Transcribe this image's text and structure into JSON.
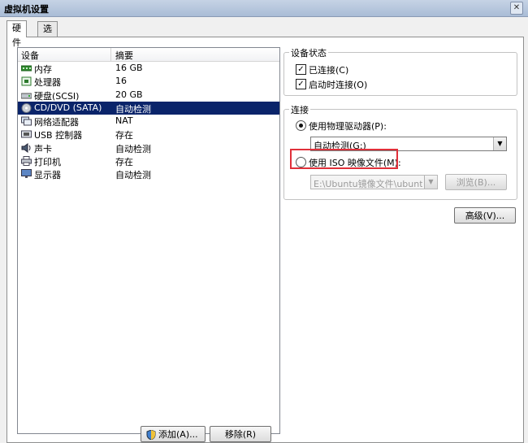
{
  "window": {
    "title": "虚拟机设置",
    "close": "✕"
  },
  "tabs": [
    {
      "label": "硬件"
    },
    {
      "label": "选项"
    }
  ],
  "device_list": {
    "headers": {
      "device": "设备",
      "summary": "摘要"
    },
    "rows": [
      {
        "name": "内存",
        "summary": "16 GB",
        "icon": "memory-icon"
      },
      {
        "name": "处理器",
        "summary": "16",
        "icon": "processor-icon"
      },
      {
        "name": "硬盘(SCSI)",
        "summary": "20 GB",
        "icon": "hard-disk-icon"
      },
      {
        "name": "CD/DVD (SATA)",
        "summary": "自动检测",
        "icon": "cd-dvd-icon"
      },
      {
        "name": "网络适配器",
        "summary": "NAT",
        "icon": "network-adapter-icon"
      },
      {
        "name": "USB 控制器",
        "summary": "存在",
        "icon": "usb-icon"
      },
      {
        "name": "声卡",
        "summary": "自动检测",
        "icon": "speaker-icon"
      },
      {
        "name": "打印机",
        "summary": "存在",
        "icon": "printer-icon"
      },
      {
        "name": "显示器",
        "summary": "自动检测",
        "icon": "monitor-icon"
      }
    ],
    "add_button": "添加(A)...",
    "remove_button": "移除(R)"
  },
  "device_status": {
    "legend": "设备状态",
    "connected": {
      "label": "已连接(C)",
      "checked": "✓"
    },
    "connect_at_power_on": {
      "label": "启动时连接(O)",
      "checked": "✓"
    }
  },
  "connection": {
    "legend": "连接",
    "physical_drive": {
      "label": "使用物理驱动器(P):",
      "value": "自动检测(G:)"
    },
    "iso_image": {
      "label": "使用 ISO 映像文件(M):",
      "path": "E:\\Ubuntu镜像文件\\ubuntu-",
      "browse": "浏览(B)..."
    }
  },
  "advanced_button": "高级(V)...",
  "colors": {
    "selection": "#0a246a",
    "highlight": "#e0303a"
  }
}
